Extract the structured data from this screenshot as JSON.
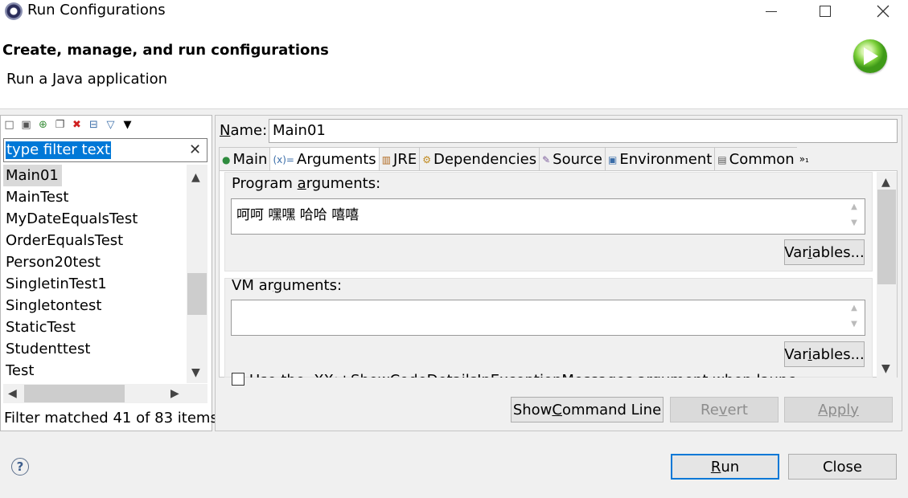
{
  "window": {
    "title": "Run Configurations",
    "minimize_icon": "minimize-icon",
    "maximize_icon": "maximize-icon",
    "close_icon": "close-icon"
  },
  "header": {
    "title": "Create, manage, and run configurations",
    "subtitle": "Run a Java application"
  },
  "left": {
    "filter_placeholder": "type filter text",
    "items": [
      "Main01",
      "MainTest",
      "MyDateEqualsTest",
      "OrderEqualsTest",
      "Person20test",
      "SingletinTest1",
      "Singletontest",
      "StaticTest",
      "Studenttest",
      "Test"
    ],
    "status": "Filter matched 41 of 83 items"
  },
  "right": {
    "name_label_prefix": "N",
    "name_label_rest": "ame:",
    "name_value": "Main01",
    "tabs": [
      "Main",
      "Arguments",
      "JRE",
      "Dependencies",
      "Source",
      "Environment",
      "Common"
    ],
    "tab_more": "»₁",
    "program_args_label_a": "Program ",
    "program_args_label_u": "a",
    "program_args_label_b": "rguments:",
    "program_args_value": "呵呵 嘿嘿 哈哈 嘻嘻",
    "variables_a": "Var",
    "variables_u": "i",
    "variables_b": "ables...",
    "vm_args_label_a": "VM ar",
    "vm_args_label_u": "g",
    "vm_args_label_b": "uments:",
    "vm_args_value": "",
    "truncated_option": "Use the -XX:+ShowCodeDetailsInExceptionMessages argument when launching",
    "show_cmd_a": "Show ",
    "show_cmd_u": "C",
    "show_cmd_b": "ommand Line",
    "revert_a": "Re",
    "revert_u": "v",
    "revert_b": "ert",
    "apply_a": "Apply",
    "apply_u": "",
    "apply_b": ""
  },
  "footer": {
    "run_u": "R",
    "run_rest": "un",
    "close": "Close",
    "help": "?"
  }
}
